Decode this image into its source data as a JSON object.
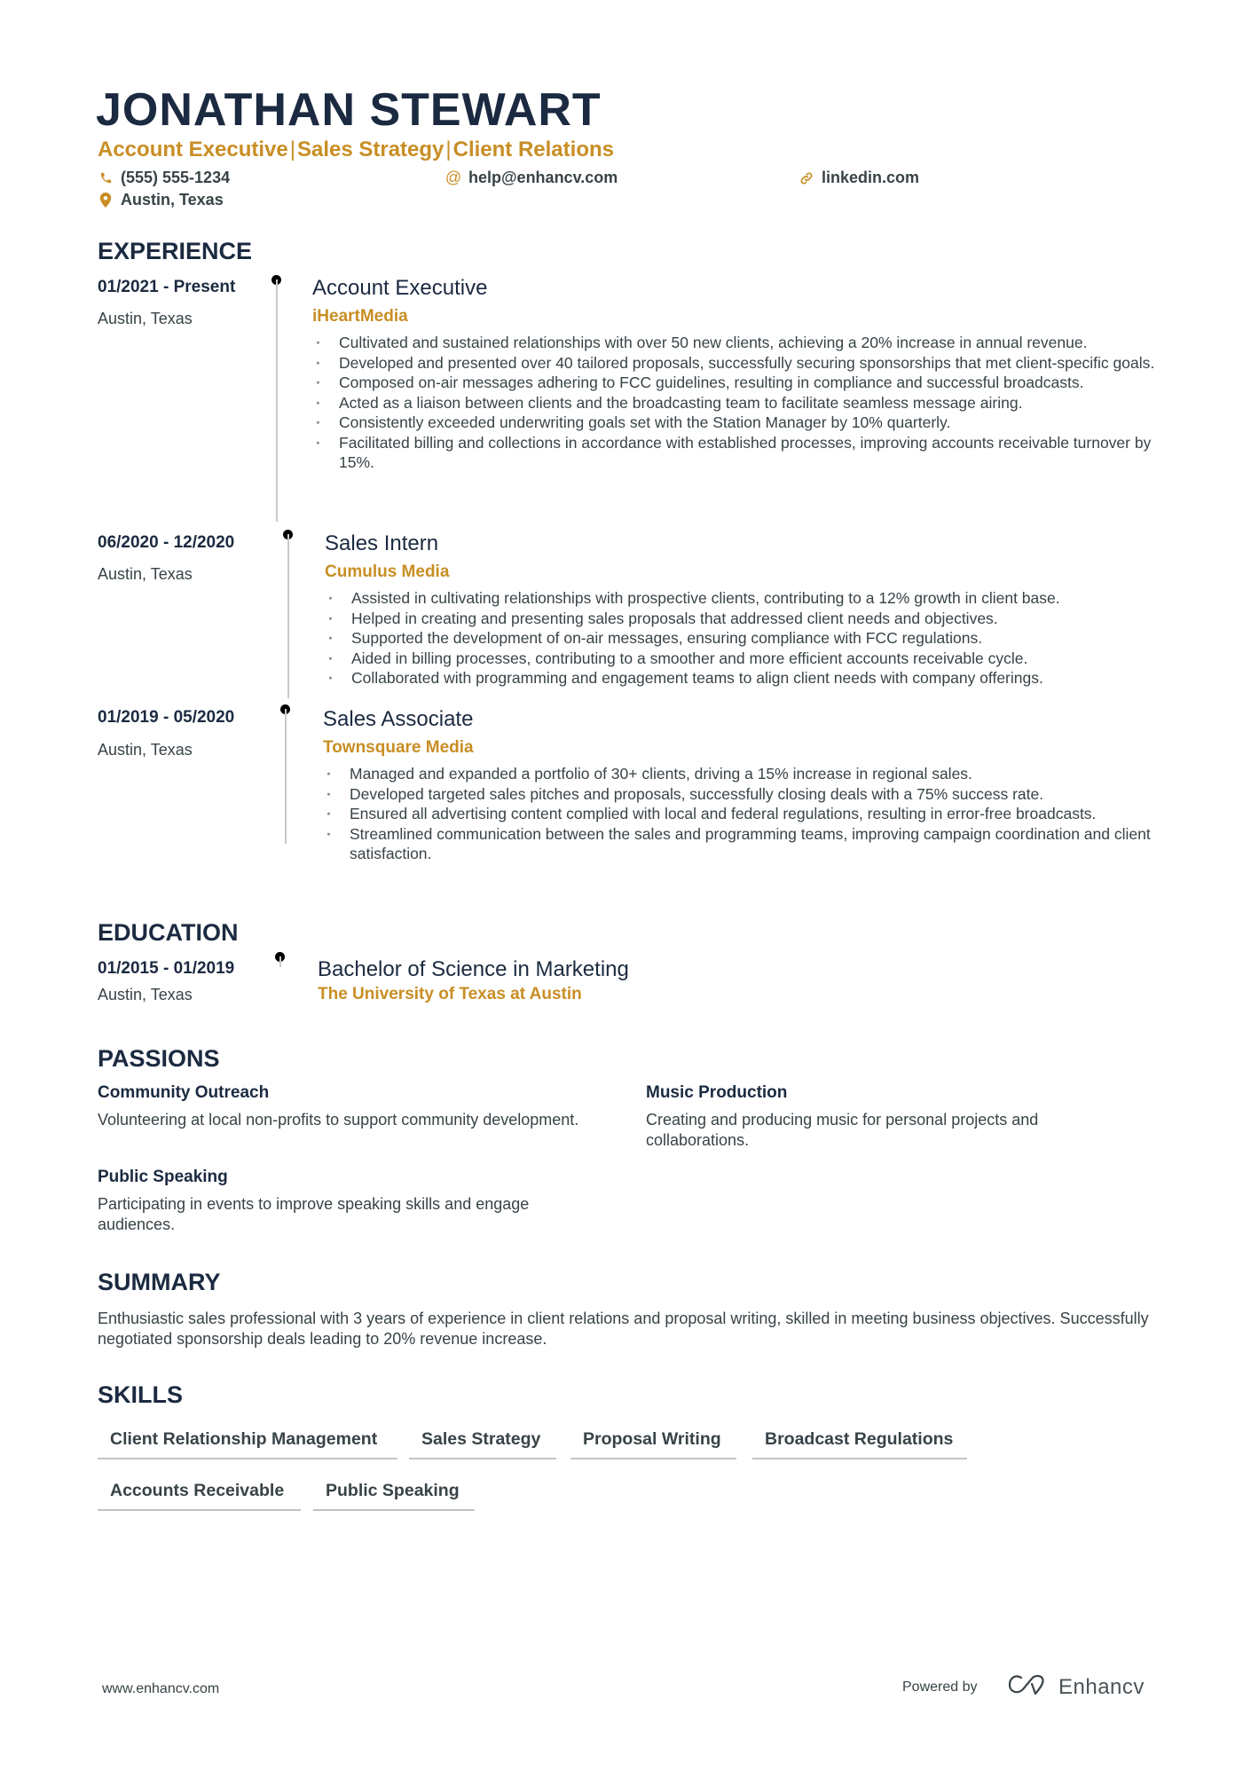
{
  "header": {
    "name": "JONATHAN STEWART",
    "headline": [
      "Account Executive",
      "Sales Strategy",
      "Client Relations"
    ],
    "headline_separator": "|",
    "contacts": {
      "phone": {
        "icon": "phone-icon",
        "value": "(555) 555-1234"
      },
      "email": {
        "icon": "at-icon",
        "value": "help@enhancv.com"
      },
      "linkedin": {
        "icon": "link-icon",
        "value": "linkedin.com"
      },
      "location": {
        "icon": "location-pin-icon",
        "value": "Austin, Texas"
      }
    }
  },
  "experience": {
    "title": "EXPERIENCE",
    "items": [
      {
        "dates": "01/2021 - Present",
        "location": "Austin, Texas",
        "role": "Account Executive",
        "company": "iHeartMedia",
        "bullets": [
          "Cultivated and sustained relationships with over 50 new clients, achieving a 20% increase in annual revenue.",
          "Developed and presented over 40 tailored proposals, successfully securing sponsorships that met client-specific goals.",
          "Composed on-air messages adhering to FCC guidelines, resulting in compliance and successful broadcasts.",
          "Acted as a liaison between clients and the broadcasting team to facilitate seamless message airing.",
          "Consistently exceeded underwriting goals set with the Station Manager by 10% quarterly.",
          "Facilitated billing and collections in accordance with established processes, improving accounts receivable turnover by 15%."
        ]
      },
      {
        "dates": "06/2020 - 12/2020",
        "location": "Austin, Texas",
        "role": "Sales Intern",
        "company": "Cumulus Media",
        "bullets": [
          "Assisted in cultivating relationships with prospective clients, contributing to a 12% growth in client base.",
          "Helped in creating and presenting sales proposals that addressed client needs and objectives.",
          "Supported the development of on-air messages, ensuring compliance with FCC regulations.",
          "Aided in billing processes, contributing to a smoother and more efficient accounts receivable cycle.",
          "Collaborated with programming and engagement teams to align client needs with company offerings."
        ]
      },
      {
        "dates": "01/2019 - 05/2020",
        "location": "Austin, Texas",
        "role": "Sales Associate",
        "company": "Townsquare Media",
        "bullets": [
          "Managed and expanded a portfolio of 30+ clients, driving a 15% increase in regional sales.",
          "Developed targeted sales pitches and proposals, successfully closing deals with a 75% success rate.",
          "Ensured all advertising content complied with local and federal regulations, resulting in error-free broadcasts.",
          "Streamlined communication between the sales and programming teams, improving campaign coordination and client satisfaction."
        ]
      }
    ]
  },
  "education": {
    "title": "EDUCATION",
    "items": [
      {
        "dates": "01/2015 - 01/2019",
        "location": "Austin, Texas",
        "degree": "Bachelor of Science in Marketing",
        "school": "The University of Texas at Austin"
      }
    ]
  },
  "passions": {
    "title": "PASSIONS",
    "items": [
      {
        "title": "Community Outreach",
        "description": "Volunteering at local non-profits to support community development."
      },
      {
        "title": "Music Production",
        "description": "Creating and producing music for personal projects and collaborations."
      },
      {
        "title": "Public Speaking",
        "description": "Participating in events to improve speaking skills and engage audiences."
      }
    ]
  },
  "summary": {
    "title": "SUMMARY",
    "text": "Enthusiastic sales professional with 3 years of experience in client relations and proposal writing, skilled in meeting business objectives. Successfully negotiated sponsorship deals leading to 20% revenue increase."
  },
  "skills": {
    "title": "SKILLS",
    "items": [
      "Client Relationship Management",
      "Sales Strategy",
      "Proposal Writing",
      "Broadcast Regulations",
      "Accounts Receivable",
      "Public Speaking"
    ]
  },
  "footer": {
    "url": "www.enhancv.com",
    "powered_by": "Powered by",
    "brand": "Enhancv",
    "brand_icon": "enhancv-logo-icon"
  },
  "colors": {
    "navy": "#1b2a40",
    "accent_gold": "#c88e24",
    "body_text": "#384347",
    "timeline_line": "#c9c9c9"
  }
}
